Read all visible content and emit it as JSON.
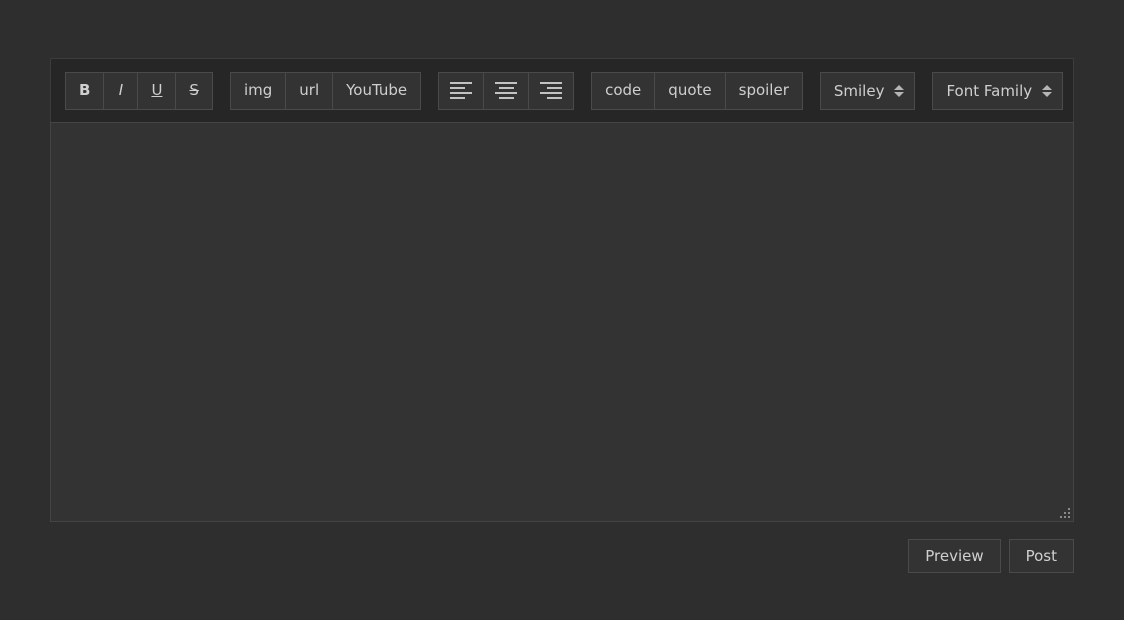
{
  "toolbar": {
    "format_group": [
      {
        "label": "B",
        "name": "bold-button",
        "style": "bold"
      },
      {
        "label": "I",
        "name": "italic-button",
        "style": "italic"
      },
      {
        "label": "U",
        "name": "underline-button",
        "style": "under"
      },
      {
        "label": "S",
        "name": "strikethrough-button",
        "style": "strike"
      }
    ],
    "media_group": [
      {
        "label": "img",
        "name": "image-button"
      },
      {
        "label": "url",
        "name": "link-button"
      },
      {
        "label": "YouTube",
        "name": "youtube-button"
      }
    ],
    "align_group": [
      {
        "icon": "align-left-icon",
        "name": "align-left-button"
      },
      {
        "icon": "align-center-icon",
        "name": "align-center-button"
      },
      {
        "icon": "align-right-icon",
        "name": "align-right-button"
      }
    ],
    "block_group": [
      {
        "label": "code",
        "name": "code-button"
      },
      {
        "label": "quote",
        "name": "quote-button"
      },
      {
        "label": "spoiler",
        "name": "spoiler-button"
      }
    ],
    "selects": [
      {
        "label": "Smiley",
        "name": "smiley-select"
      },
      {
        "label": "Font Family",
        "name": "font-family-select"
      }
    ]
  },
  "composer": {
    "value": "",
    "placeholder": ""
  },
  "actions": [
    {
      "label": "Preview",
      "name": "preview-button"
    },
    {
      "label": "Post",
      "name": "post-button"
    }
  ],
  "colors": {
    "page_background": "#2e2e2e",
    "toolbar_background": "#262626",
    "button_background": "#333333",
    "button_border": "#4a4a4a",
    "text": "#cfcfcf"
  }
}
